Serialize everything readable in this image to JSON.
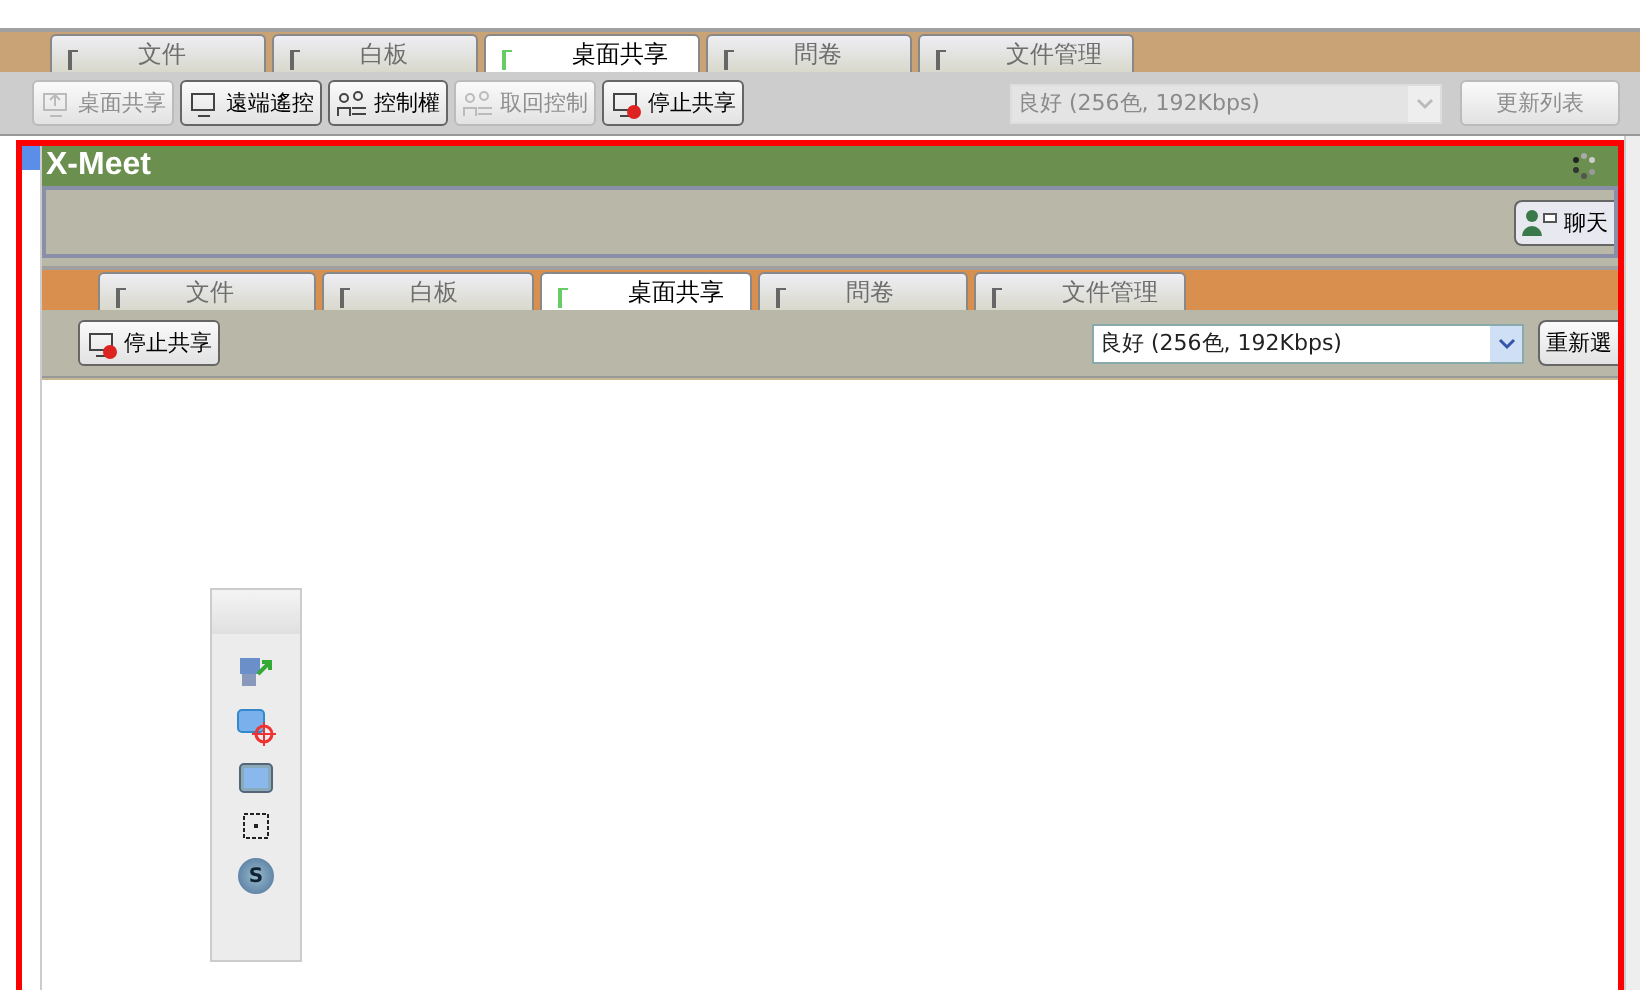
{
  "outer_tabs": [
    {
      "label": "文件",
      "selected": false
    },
    {
      "label": "白板",
      "selected": false
    },
    {
      "label": "桌面共享",
      "selected": true
    },
    {
      "label": "問卷",
      "selected": false
    },
    {
      "label": "文件管理",
      "selected": false
    }
  ],
  "outer_toolbar": {
    "buttons": [
      {
        "label": "桌面共享",
        "kind": "share",
        "disabled": true
      },
      {
        "label": "遠端遙控",
        "kind": "remote",
        "disabled": false
      },
      {
        "label": "控制權",
        "kind": "control",
        "disabled": false
      },
      {
        "label": "取回控制",
        "kind": "reclaim",
        "disabled": true
      },
      {
        "label": "停止共享",
        "kind": "stop",
        "disabled": false
      }
    ],
    "quality": {
      "value": "良好 (256色, 192Kbps)",
      "disabled": true
    },
    "refresh": {
      "label": "更新列表",
      "disabled": true
    }
  },
  "app": {
    "logo": "X-Meet",
    "chat_button": "聊天",
    "tabs": [
      {
        "label": "文件",
        "selected": false
      },
      {
        "label": "白板",
        "selected": false
      },
      {
        "label": "桌面共享",
        "selected": true
      },
      {
        "label": "問卷",
        "selected": false
      },
      {
        "label": "文件管理",
        "selected": false
      }
    ],
    "toolbar": {
      "stop_button": "停止共享",
      "quality": {
        "value": "良好 (256色, 192Kbps)",
        "disabled": false
      },
      "reselect_button": "重新選"
    },
    "floating_tools": [
      {
        "kind": "swap"
      },
      {
        "kind": "target"
      },
      {
        "kind": "window"
      },
      {
        "kind": "region"
      },
      {
        "kind": "badge",
        "label": "S"
      }
    ]
  }
}
